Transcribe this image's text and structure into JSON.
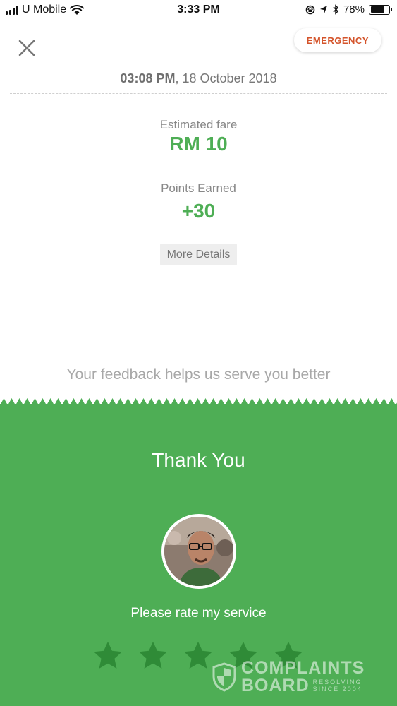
{
  "status_bar": {
    "carrier": "U Mobile",
    "time": "3:33 PM",
    "battery": "78%",
    "battery_level": 0.78,
    "icons": [
      "signal-icon",
      "wifi-icon",
      "location-lock-icon",
      "location-arrow-icon",
      "bluetooth-icon",
      "battery-icon"
    ]
  },
  "header": {
    "close_icon": "close-icon",
    "emergency_label": "EMERGENCY"
  },
  "trip": {
    "time": "03:08 PM",
    "date": ", 18 October 2018"
  },
  "fare": {
    "label": "Estimated fare",
    "value": "RM 10"
  },
  "points": {
    "label": "Points Earned",
    "value": "+30"
  },
  "more_details_label": "More Details",
  "feedback_text": "Your feedback helps us serve you better",
  "rating": {
    "title": "Thank You",
    "prompt": "Please rate my service",
    "star_count": 5,
    "selected": 0
  },
  "watermark": {
    "line1": "COMPLAINTS",
    "line2": "BOARD",
    "tag1": "RESOLVING",
    "tag2": "SINCE 2004"
  },
  "colors": {
    "accent_green": "#4eae55",
    "emergency_red": "#d4542b",
    "star_dark": "#2f8b37"
  }
}
